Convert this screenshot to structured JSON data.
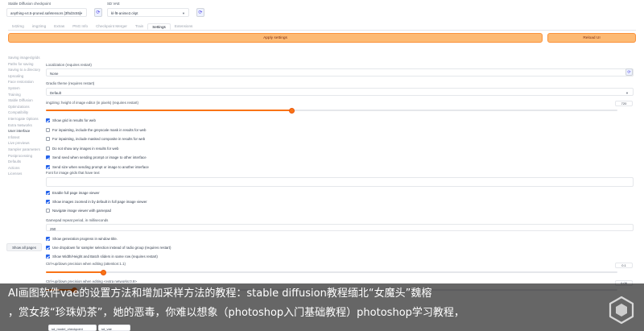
{
  "top": {
    "checkpoint_label": "Stable Diffusion checkpoint",
    "checkpoint_value": "anything-v4.5-pruned.safetensors [3f5d3c55]",
    "vae_label": "SD VAE",
    "vae_value": "kl-f8-anime2.ckpt",
    "refresh_icon": "refresh-icon"
  },
  "tabs": [
    "txt2img",
    "img2img",
    "Extras",
    "PNG Info",
    "Checkpoint Merger",
    "Train",
    "Settings",
    "Extensions"
  ],
  "active_tab": "Settings",
  "buttons": {
    "apply": "Apply settings",
    "reload": "Reload UI",
    "show_all": "Show all pages"
  },
  "sidebar": {
    "items": [
      "Saving images/grids",
      "Paths for saving",
      "Saving to a directory",
      "Upscaling",
      "Face restoration",
      "System",
      "Training",
      "Stable Diffusion",
      "Optimizations",
      "Compatibility",
      "Interrogate Options",
      "Extra Networks",
      "User interface",
      "Infotext",
      "Live previews",
      "Sampler parameters",
      "Postprocessing",
      "Defaults",
      "Actions",
      "Licenses"
    ],
    "active_index": 12
  },
  "settings": {
    "localization_label": "Localization (requires restart)",
    "localization_value": "None",
    "gradio_label": "Gradio theme (requires restart)",
    "gradio_value": "Default",
    "img2img_label": "img2img: height of image editor (in pixels) (requires restart)",
    "img2img_value": "720",
    "img2img_fraction": 0.43,
    "checkboxes_a": [
      {
        "label": "Show grid in results for web",
        "checked": true
      },
      {
        "label": "For inpainting, include the greyscale mask in results for web",
        "checked": false
      },
      {
        "label": "For inpainting, include masked composite in results for web",
        "checked": false
      },
      {
        "label": "Do not show any images in results for web",
        "checked": false
      },
      {
        "label": "Send seed when sending prompt or image to other interface",
        "checked": true
      },
      {
        "label": "Send size when sending prompt or image to another interface",
        "checked": true
      }
    ],
    "font_label": "Font for image grids that have text",
    "checkboxes_b": [
      {
        "label": "Enable full page image viewer",
        "checked": true
      },
      {
        "label": "Show images zoomed in by default in full page image viewer",
        "checked": true
      },
      {
        "label": "Navigate image viewer with gamepad",
        "checked": false
      }
    ],
    "gamepad_label": "Gamepad repeat period, in milliseconds",
    "gamepad_value": "250",
    "checkboxes_c": [
      {
        "label": "Show generation progress in window title.",
        "checked": true
      },
      {
        "label": "Use dropdown for sampler selection instead of radio group (requires restart)",
        "checked": true
      },
      {
        "label": "Show Width/Height and Batch sliders in same row (requires restart)",
        "checked": true
      }
    ],
    "ctrl_label": "Ctrl+up/down precision when editing (attention:1.1)",
    "ctrl_value": "0.1",
    "ctrl_fraction": 0.1,
    "ctrl2_label": "Ctrl+up/down precision when editing <extra networks:0.9>",
    "ctrl2_value": "0.05",
    "ctrl2_fraction": 0.05,
    "bottom_select_1": "sd_model_checkpoint",
    "bottom_select_2": "sd_vae"
  },
  "caption": {
    "line1": "AI画图软件vae的设置方法和增加采样方法的教程：stable diffusion教程缅北“女魔头”魏榕",
    "line2": "，赏女孩“珍珠奶茶”，她的恶毒，你难以想象（photoshop入门基础教程）photoshop学习教程，"
  },
  "colors": {
    "accent": "#f97316",
    "apply_bg": "#fdba74",
    "checkbox": "#2563eb"
  }
}
